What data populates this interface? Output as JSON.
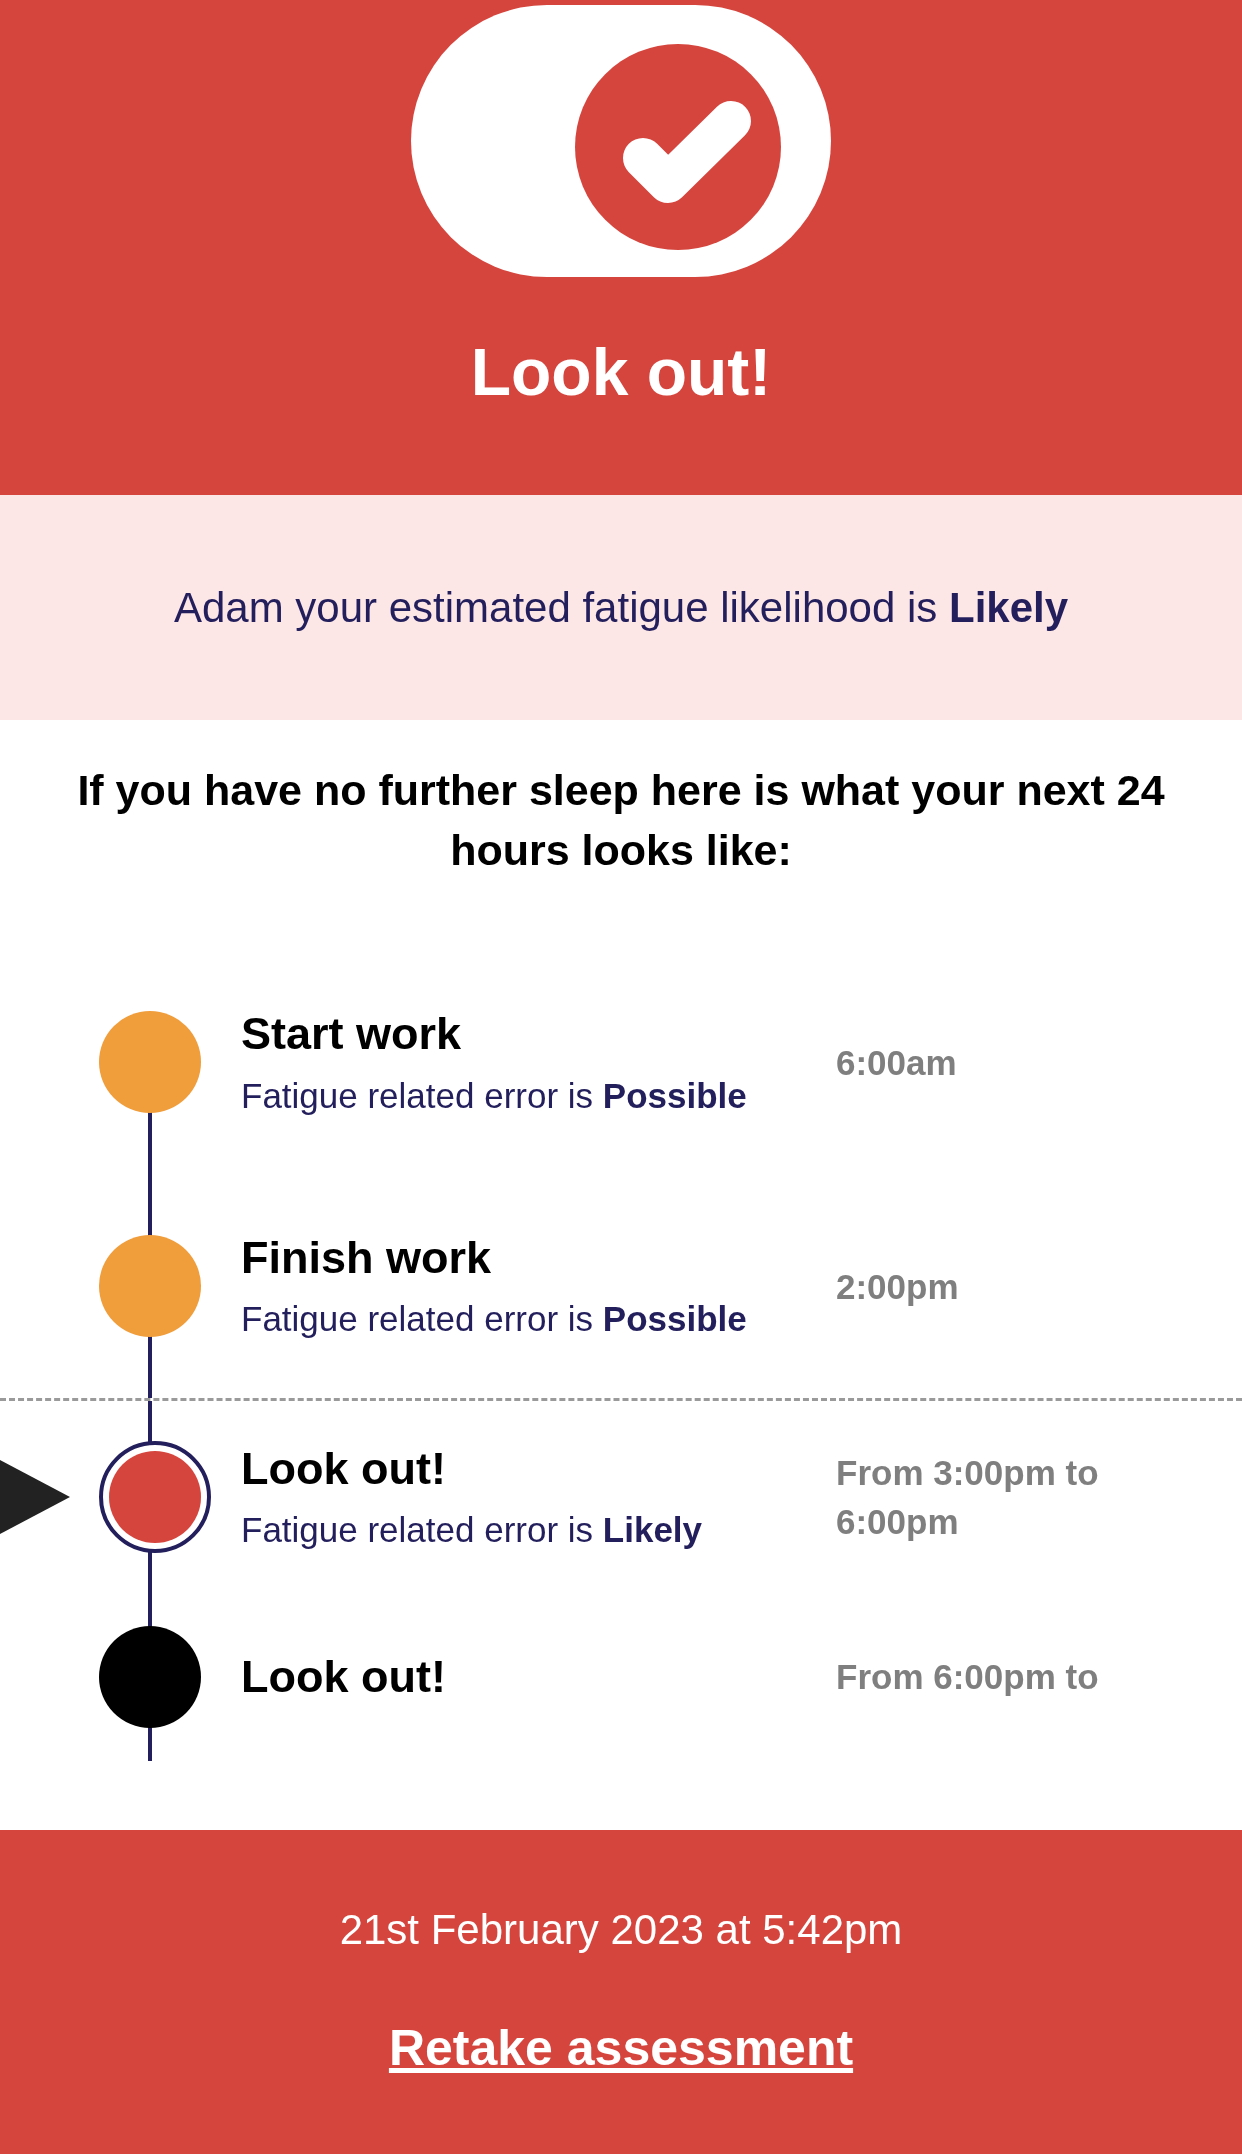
{
  "header": {
    "title": "Look out!"
  },
  "summary": "Adam your estimated fatigue likelihood is **Likely**",
  "intro": "If you have no further sleep here is what your next 24 hours looks like:",
  "timeline": [
    {
      "title": "Start work",
      "description": "Fatigue related error is **Possible**",
      "time": "6:00am",
      "color": "#f09d3c",
      "selected": false
    },
    {
      "title": "Finish work",
      "description": "Fatigue related error is **Possible**",
      "time": "2:00pm",
      "color": "#f09d3c",
      "selected": false
    },
    {
      "title": "Look out!",
      "description": "Fatigue related error is **Likely**",
      "time": "From 3:00pm to 6:00pm",
      "color": "#d6453d",
      "selected": true
    },
    {
      "title": "Look out!",
      "time": "From 6:00pm to",
      "color": "#000000",
      "selected": false
    }
  ],
  "footer": {
    "timestamp": "21st February 2023 at 5:42pm",
    "link": "Retake assessment"
  }
}
